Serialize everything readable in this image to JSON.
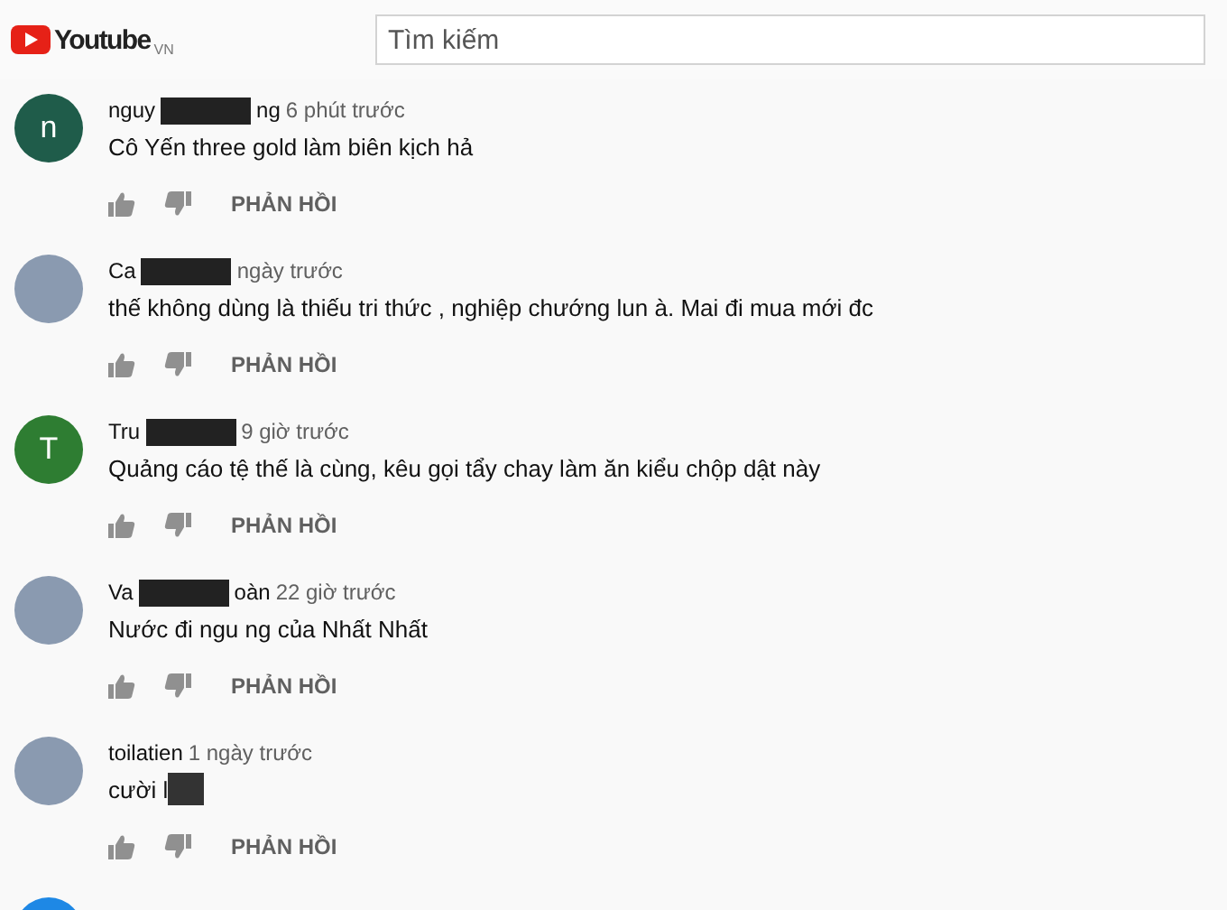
{
  "header": {
    "logo_text": "Youtube",
    "region": "VN",
    "search": {
      "placeholder": "Tìm kiếm"
    }
  },
  "comments": [
    {
      "author_parts": [
        {
          "kind": "text",
          "text": "nguy"
        },
        {
          "kind": "redacted"
        },
        {
          "kind": "text",
          "text": "ng"
        }
      ],
      "time": "6 phút trước",
      "text_parts": [
        {
          "kind": "text",
          "text": "Cô Yến three gold làm biên kịch hả"
        }
      ],
      "avatar": {
        "kind": "letter",
        "letter": "n",
        "color": "#1f5c4a"
      },
      "reply": "PHẢN HỒI"
    },
    {
      "author_parts": [
        {
          "kind": "text",
          "text": "Ca"
        },
        {
          "kind": "redacted"
        }
      ],
      "time": "ngày trước",
      "text_parts": [
        {
          "kind": "text",
          "text": "thế không dùng là thiếu tri thức , nghiệp chướng lun à. Mai đi mua mới đc"
        }
      ],
      "avatar": {
        "kind": "photo"
      },
      "reply": "PHẢN HỒI"
    },
    {
      "author_parts": [
        {
          "kind": "text",
          "text": "Tru"
        },
        {
          "kind": "redacted"
        }
      ],
      "time": "9 giờ trước",
      "text_parts": [
        {
          "kind": "text",
          "text": "Quảng cáo tệ thế là cùng, kêu gọi tẩy chay làm ăn kiểu chộp dật này"
        }
      ],
      "avatar": {
        "kind": "letter",
        "letter": "T",
        "color": "#2e7d32"
      },
      "reply": "PHẢN HỒI"
    },
    {
      "author_parts": [
        {
          "kind": "text",
          "text": "Va"
        },
        {
          "kind": "redacted"
        },
        {
          "kind": "text",
          "text": "oàn"
        }
      ],
      "time": "22 giờ trước",
      "text_parts": [
        {
          "kind": "text",
          "text": "Nước đi ngu ng của Nhất Nhất"
        }
      ],
      "avatar": {
        "kind": "photo"
      },
      "reply": "PHẢN HỒI"
    },
    {
      "author_parts": [
        {
          "kind": "text",
          "text": "toilatien"
        }
      ],
      "time": "1 ngày trước",
      "text_parts": [
        {
          "kind": "text",
          "text": "cười l"
        },
        {
          "kind": "redacted"
        }
      ],
      "avatar": {
        "kind": "photo"
      },
      "reply": "PHẢN HỒI"
    },
    {
      "avatar": {
        "kind": "letter",
        "color": "#1e88e5"
      }
    }
  ]
}
